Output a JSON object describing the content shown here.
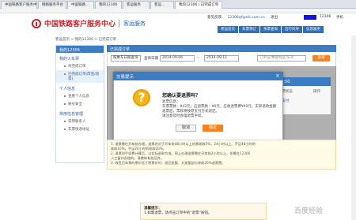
{
  "browser": {
    "tabs": [
      "中国铁路客户服务中心",
      "网络服务平台",
      "中国铁路...",
      "我的12306",
      "客运服务",
      "客运...",
      "我的12306 | 已完成订单"
    ]
  },
  "header": {
    "brand": "中国铁路客户服务中心",
    "brand_sub": "客运服务",
    "top_links": [
      "意见反馈",
      "12306qf@sik.com.cn",
      "退出",
      "12306",
      "手机"
    ],
    "nav": [
      "客运首页",
      "车票预订",
      "余票查询",
      "出行向导",
      "信息服务"
    ]
  },
  "breadcrumb": "客运首页 > 我的12306 > 已完成订单",
  "sidebar": {
    "title": "我的12306",
    "sections": [
      {
        "label": "我的火车票",
        "items": [
          "未完成订单",
          "已完成订单(改签/退票)"
        ]
      },
      {
        "label": "个人信息",
        "items": [
          "查看个人信息",
          "账号安全"
        ]
      },
      {
        "label": "常用信息管理",
        "items": [
          "常用联系人",
          "车票快递地址"
        ]
      }
    ]
  },
  "main": {
    "title": "已完成订单",
    "search": {
      "date_type": "按乘车日期查询",
      "query_label": "查询日期",
      "start_date": "2014-09-06",
      "to": "--",
      "end_date": "2014-09-11",
      "keyword_placeholder": "订单号/乘客姓名/车次",
      "button": "查询"
    },
    "order": {
      "header": "07:50",
      "status": "已支付",
      "action": "操作",
      "col": "车票状态"
    }
  },
  "dialog": {
    "title": "交易提示",
    "close": "×",
    "question": "您确认要退票吗？",
    "lines": [
      "退票信息：",
      "车票票款：¥42元，应退票款：¥0元，应收退票费¥40元，实际退款金额",
      "退票后，票款将按原支付方式退还。",
      "请注意及时办理退票手续。"
    ],
    "cancel": "取消",
    "ok": "确定"
  },
  "notice": [
    "1. 退票需在开车前办理，退票时对于开车前48小时以上的票收取5%，24小时以上、不足48小时的",
    "   收取10%，不足24小时的收取20%。",
    "2. 退票时手续费计算后，以实际退款为准。网上办理退票需在开车前2小时以上，如需在12306",
    "   人工窗口办理的，请携带有效证件。",
    "3. 改签后车票的票价低于原票价时，退还差额，对差额部分收取20%退票费。"
  ],
  "tip": {
    "title": "温馨提示：",
    "line": "1.如需退票，请点击订单中的“退票”按钮。"
  },
  "watermark": "百度经验",
  "colors": {
    "brand_red": "#c0272d",
    "nav_blue": "#2f6fb5",
    "accent_orange": "#f5821f"
  }
}
